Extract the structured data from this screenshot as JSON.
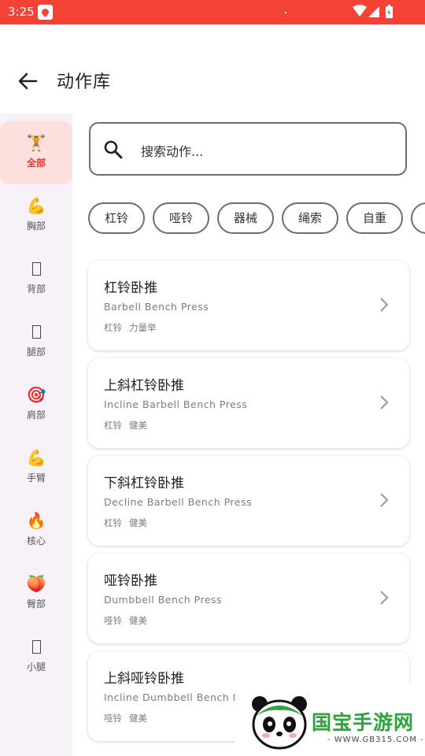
{
  "status_bar": {
    "time": "3:25"
  },
  "header": {
    "title": "动作库"
  },
  "sidebar": {
    "items": [
      {
        "label": "全部",
        "icon": "weightlifter-icon",
        "glyph": "🏋",
        "active": true
      },
      {
        "label": "胸部",
        "icon": "flexed-biceps-icon",
        "glyph": "💪"
      },
      {
        "label": "背部",
        "icon": "missing-glyph-icon",
        "glyph": ""
      },
      {
        "label": "腿部",
        "icon": "missing-glyph-icon",
        "glyph": ""
      },
      {
        "label": "肩部",
        "icon": "target-icon",
        "glyph": "🎯"
      },
      {
        "label": "手臂",
        "icon": "flexed-biceps-icon",
        "glyph": "💪"
      },
      {
        "label": "核心",
        "icon": "fire-icon",
        "glyph": "🔥"
      },
      {
        "label": "臀部",
        "icon": "peach-icon",
        "glyph": "🍑"
      },
      {
        "label": "小腿",
        "icon": "missing-glyph-icon",
        "glyph": ""
      }
    ]
  },
  "search": {
    "placeholder": "搜索动作..."
  },
  "filters": [
    "杠铃",
    "哑铃",
    "器械",
    "绳索",
    "自重"
  ],
  "exercises": [
    {
      "name": "杠铃卧推",
      "english": "Barbell Bench Press",
      "tags": [
        "杠铃",
        "力量举"
      ]
    },
    {
      "name": "上斜杠铃卧推",
      "english": "Incline Barbell Bench Press",
      "tags": [
        "杠铃",
        "健美"
      ]
    },
    {
      "name": "下斜杠铃卧推",
      "english": "Decline Barbell Bench Press",
      "tags": [
        "杠铃",
        "健美"
      ]
    },
    {
      "name": "哑铃卧推",
      "english": "Dumbbell Bench Press",
      "tags": [
        "哑铃",
        "健美"
      ]
    },
    {
      "name": "上斜哑铃卧推",
      "english": "Incline Dumbbell Bench Press",
      "tags": [
        "哑铃",
        "健美"
      ]
    }
  ],
  "watermark": {
    "brand": "国宝手游网",
    "url": "- WWW.GB315.COM -"
  },
  "colors": {
    "status_bar": "#f44336",
    "active_nav_bg": "#fde0dd",
    "active_nav_text": "#e53935",
    "sidebar_bg": "#f7f2f8",
    "brand_green": "#2fa33f"
  }
}
